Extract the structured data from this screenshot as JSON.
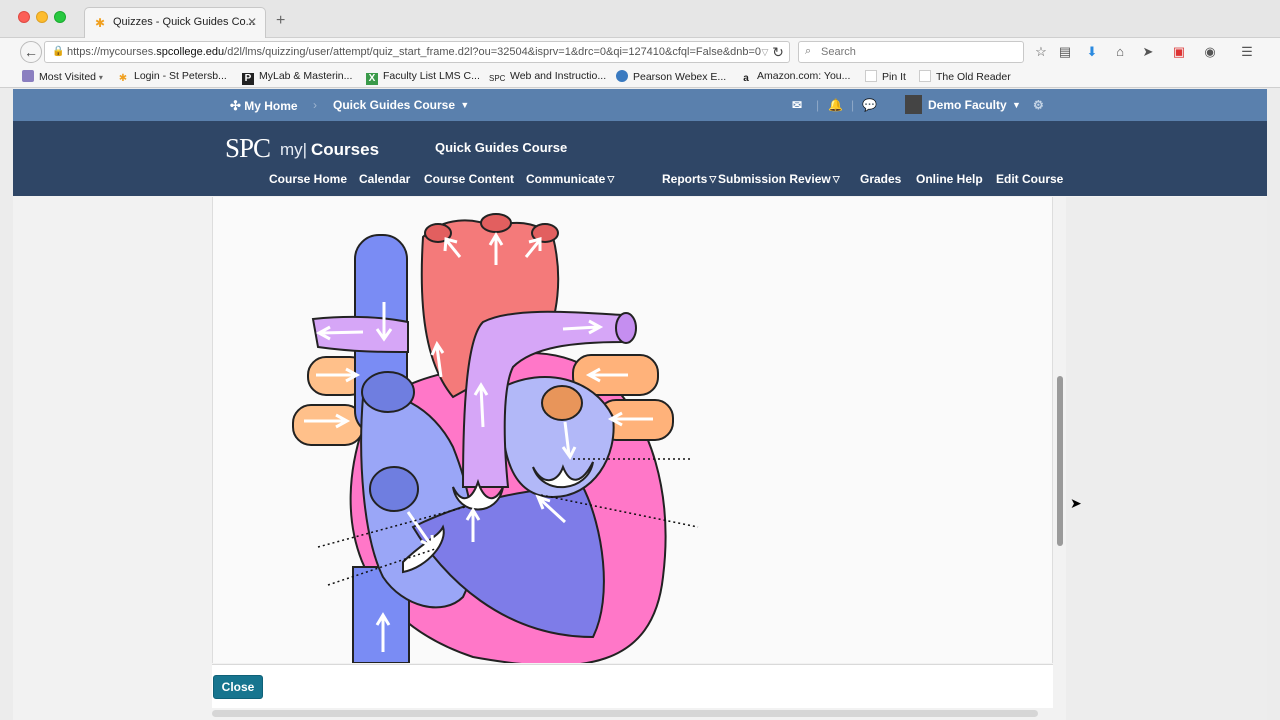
{
  "browser": {
    "tab_title": "Quizzes - Quick Guides Co...",
    "url_prefix": "https://mycourses.",
    "url_domain": "spcollege.edu",
    "url_path": "/d2l/lms/quizzing/user/attempt/quiz_start_frame.d2l?ou=32504&isprv=1&drc=0&qi=127410&cfql=False&dnb=0",
    "search_placeholder": "Search",
    "bookmarks": [
      "Most Visited",
      "Login - St Petersb...",
      "MyLab & Masterin...",
      "Faculty List LMS C...",
      "Web and Instructio...",
      "Pearson Webex E...",
      "Amazon.com: You...",
      "Pin It",
      "The Old Reader"
    ]
  },
  "minibar": {
    "home": "My Home",
    "course": "Quick Guides Course",
    "user": "Demo Faculty"
  },
  "header": {
    "logo_spc": "SPC",
    "logo_my": "my|",
    "logo_courses": "Courses",
    "course_title": "Quick Guides Course",
    "nav": [
      "Course Home",
      "Calendar",
      "Course Content",
      "Communicate",
      "Reports",
      "Submission Review",
      "Grades",
      "Online Help",
      "Edit Course"
    ]
  },
  "footer": {
    "close_label": "Close"
  },
  "colors": {
    "minibar": "#5a80ad",
    "header": "#2f4666",
    "button": "#17758f"
  }
}
